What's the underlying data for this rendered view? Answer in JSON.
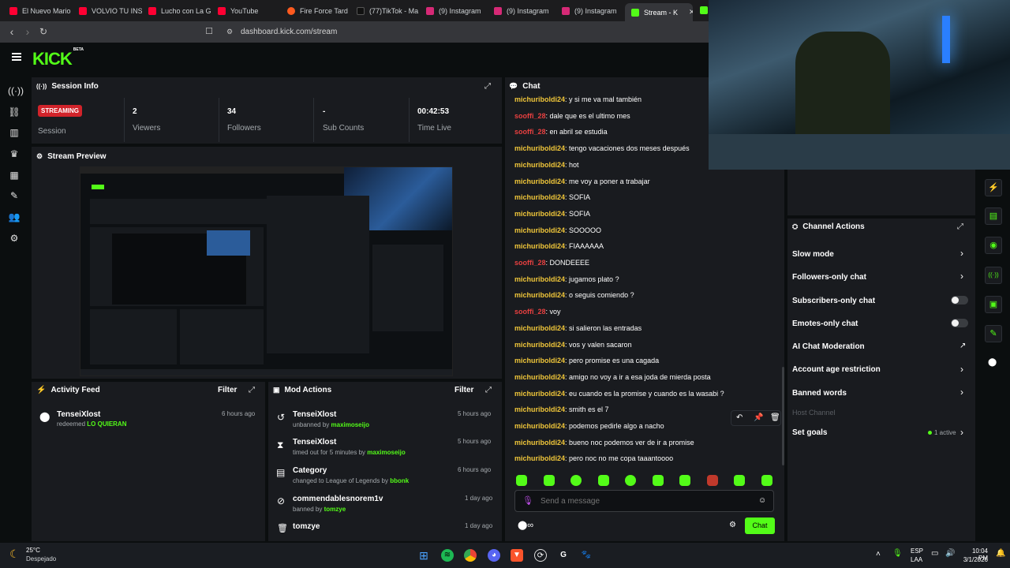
{
  "browser": {
    "tabs": [
      {
        "label": "El Nuevo Mario",
        "color": "#ff0033"
      },
      {
        "label": "VOLVIO TU INS",
        "color": "#ff0033"
      },
      {
        "label": "Lucho con La G",
        "color": "#ff0033"
      },
      {
        "label": "YouTube",
        "color": "#ff0033"
      },
      {
        "label": "Fire Force Tard",
        "color": "#ff5a1f"
      },
      {
        "label": "(77)TikTok - Ma",
        "color": "#111111"
      },
      {
        "label": "(9) Instagram",
        "color": "#d62976"
      },
      {
        "label": "(9) Instagram",
        "color": "#d62976"
      },
      {
        "label": "(9) Instagram",
        "color": "#d62976"
      },
      {
        "label": "Stream - K",
        "color": "#53fc18"
      }
    ],
    "url": "dashboard.kick.com/stream"
  },
  "header": {
    "logo": "KICK",
    "logo_sup": "BETA"
  },
  "session": {
    "title": "Session Info",
    "status": "STREAMING",
    "stats": [
      {
        "value": "",
        "label": "Session"
      },
      {
        "value": "2",
        "label": "Viewers"
      },
      {
        "value": "34",
        "label": "Followers"
      },
      {
        "value": "-",
        "label": "Sub Counts"
      },
      {
        "value": "00:42:53",
        "label": "Time Live"
      }
    ]
  },
  "preview": {
    "title": "Stream Preview"
  },
  "activity": {
    "title": "Activity Feed",
    "filter": "Filter",
    "items": [
      {
        "name": "TenseiXlost",
        "action": "redeemed",
        "target": "LO QUIERAN",
        "time": "6 hours ago"
      }
    ]
  },
  "mod": {
    "title": "Mod Actions",
    "filter": "Filter",
    "items": [
      {
        "icon": "undo-icon",
        "glyph": "↺",
        "name": "TenseiXlost",
        "action": "unbanned by",
        "target": "maximoseijo",
        "time": "5 hours ago"
      },
      {
        "icon": "hourglass-icon",
        "glyph": "⧗",
        "name": "TenseiXlost",
        "action": "timed out for 5 minutes by",
        "target": "maximoseijo",
        "time": "5 hours ago"
      },
      {
        "icon": "category-icon",
        "glyph": "▤",
        "name": "Category",
        "action": "changed to League of Legends by",
        "target": "bbonk",
        "time": "6 hours ago"
      },
      {
        "icon": "ban-icon",
        "glyph": "⊘",
        "name": "commendablesnorem1v",
        "action": "banned by",
        "target": "tomzye",
        "time": "1 day ago"
      },
      {
        "icon": "trash-icon",
        "glyph": "🗑",
        "name": "tomzye",
        "action": "",
        "target": "",
        "time": "1 day ago"
      }
    ]
  },
  "chat": {
    "title": "Chat",
    "messages": [
      {
        "user": "michuriboldi24",
        "type": "u1",
        "text": "y si me va mal también"
      },
      {
        "user": "sooffi_28",
        "type": "u2",
        "text": "dale que es el ultimo mes"
      },
      {
        "user": "sooffi_28",
        "type": "u2",
        "text": "en abril se estudia"
      },
      {
        "user": "michuriboldi24",
        "type": "u1",
        "text": "tengo vacaciones dos meses después"
      },
      {
        "user": "michuriboldi24",
        "type": "u1",
        "text": "hot"
      },
      {
        "user": "michuriboldi24",
        "type": "u1",
        "text": "me voy a poner a trabajar"
      },
      {
        "user": "michuriboldi24",
        "type": "u1",
        "text": "SOFIA"
      },
      {
        "user": "michuriboldi24",
        "type": "u1",
        "text": "SOFIA"
      },
      {
        "user": "michuriboldi24",
        "type": "u1",
        "text": "SOOOOO"
      },
      {
        "user": "michuriboldi24",
        "type": "u1",
        "text": "FIAAAAAA"
      },
      {
        "user": "sooffi_28",
        "type": "u2",
        "text": "DONDEEEE"
      },
      {
        "user": "michuriboldi24",
        "type": "u1",
        "text": "jugamos plato ?"
      },
      {
        "user": "michuriboldi24",
        "type": "u1",
        "text": "o seguis comiendo ?"
      },
      {
        "user": "sooffi_28",
        "type": "u2",
        "text": "voy"
      },
      {
        "user": "michuriboldi24",
        "type": "u1",
        "text": "si salieron las entradas"
      },
      {
        "user": "michuriboldi24",
        "type": "u1",
        "text": "vos y valen sacaron"
      },
      {
        "user": "michuriboldi24",
        "type": "u1",
        "text": "pero promise es una cagada"
      },
      {
        "user": "michuriboldi24",
        "type": "u1",
        "text": "amigo no voy a ir a esa joda de mierda posta"
      },
      {
        "user": "michuriboldi24",
        "type": "u1",
        "text": "eu cuando es la promise y cuando es la wasabi ?"
      },
      {
        "user": "michuriboldi24",
        "type": "u1",
        "text": "smith es el 7"
      },
      {
        "user": "michuriboldi24",
        "type": "u1",
        "text": "podemos pedirle algo a nacho"
      },
      {
        "user": "michuriboldi24",
        "type": "u1",
        "text": "bueno noc podemos ver de ir a promise"
      },
      {
        "user": "michuriboldi24",
        "type": "u1",
        "text": "pero noc no me copa taaantoooo"
      }
    ],
    "placeholder": "Send a message",
    "send": "Chat"
  },
  "channel_actions": {
    "title": "Channel Actions",
    "items": [
      {
        "label": "Slow mode",
        "control": "chevron"
      },
      {
        "label": "Followers-only chat",
        "control": "chevron"
      },
      {
        "label": "Subscribers-only chat",
        "control": "toggle"
      },
      {
        "label": "Emotes-only chat",
        "control": "toggle"
      },
      {
        "label": "AI Chat Moderation",
        "control": "external"
      },
      {
        "label": "Account age restriction",
        "control": "chevron"
      },
      {
        "label": "Banned words",
        "control": "chevron"
      },
      {
        "label": "Host Channel",
        "control": "none"
      },
      {
        "label": "Set goals",
        "control": "chevron"
      }
    ],
    "goals_status": "1 active"
  },
  "taskbar": {
    "weather_temp": "25°C",
    "weather_desc": "Despejado",
    "lang": "ESP",
    "lang2": "LAA",
    "time": "10:04 PM",
    "date": "3/1/2026"
  },
  "colors": {
    "accent": "#53fc18",
    "live": "#d1232a",
    "panel": "#191b1f"
  }
}
